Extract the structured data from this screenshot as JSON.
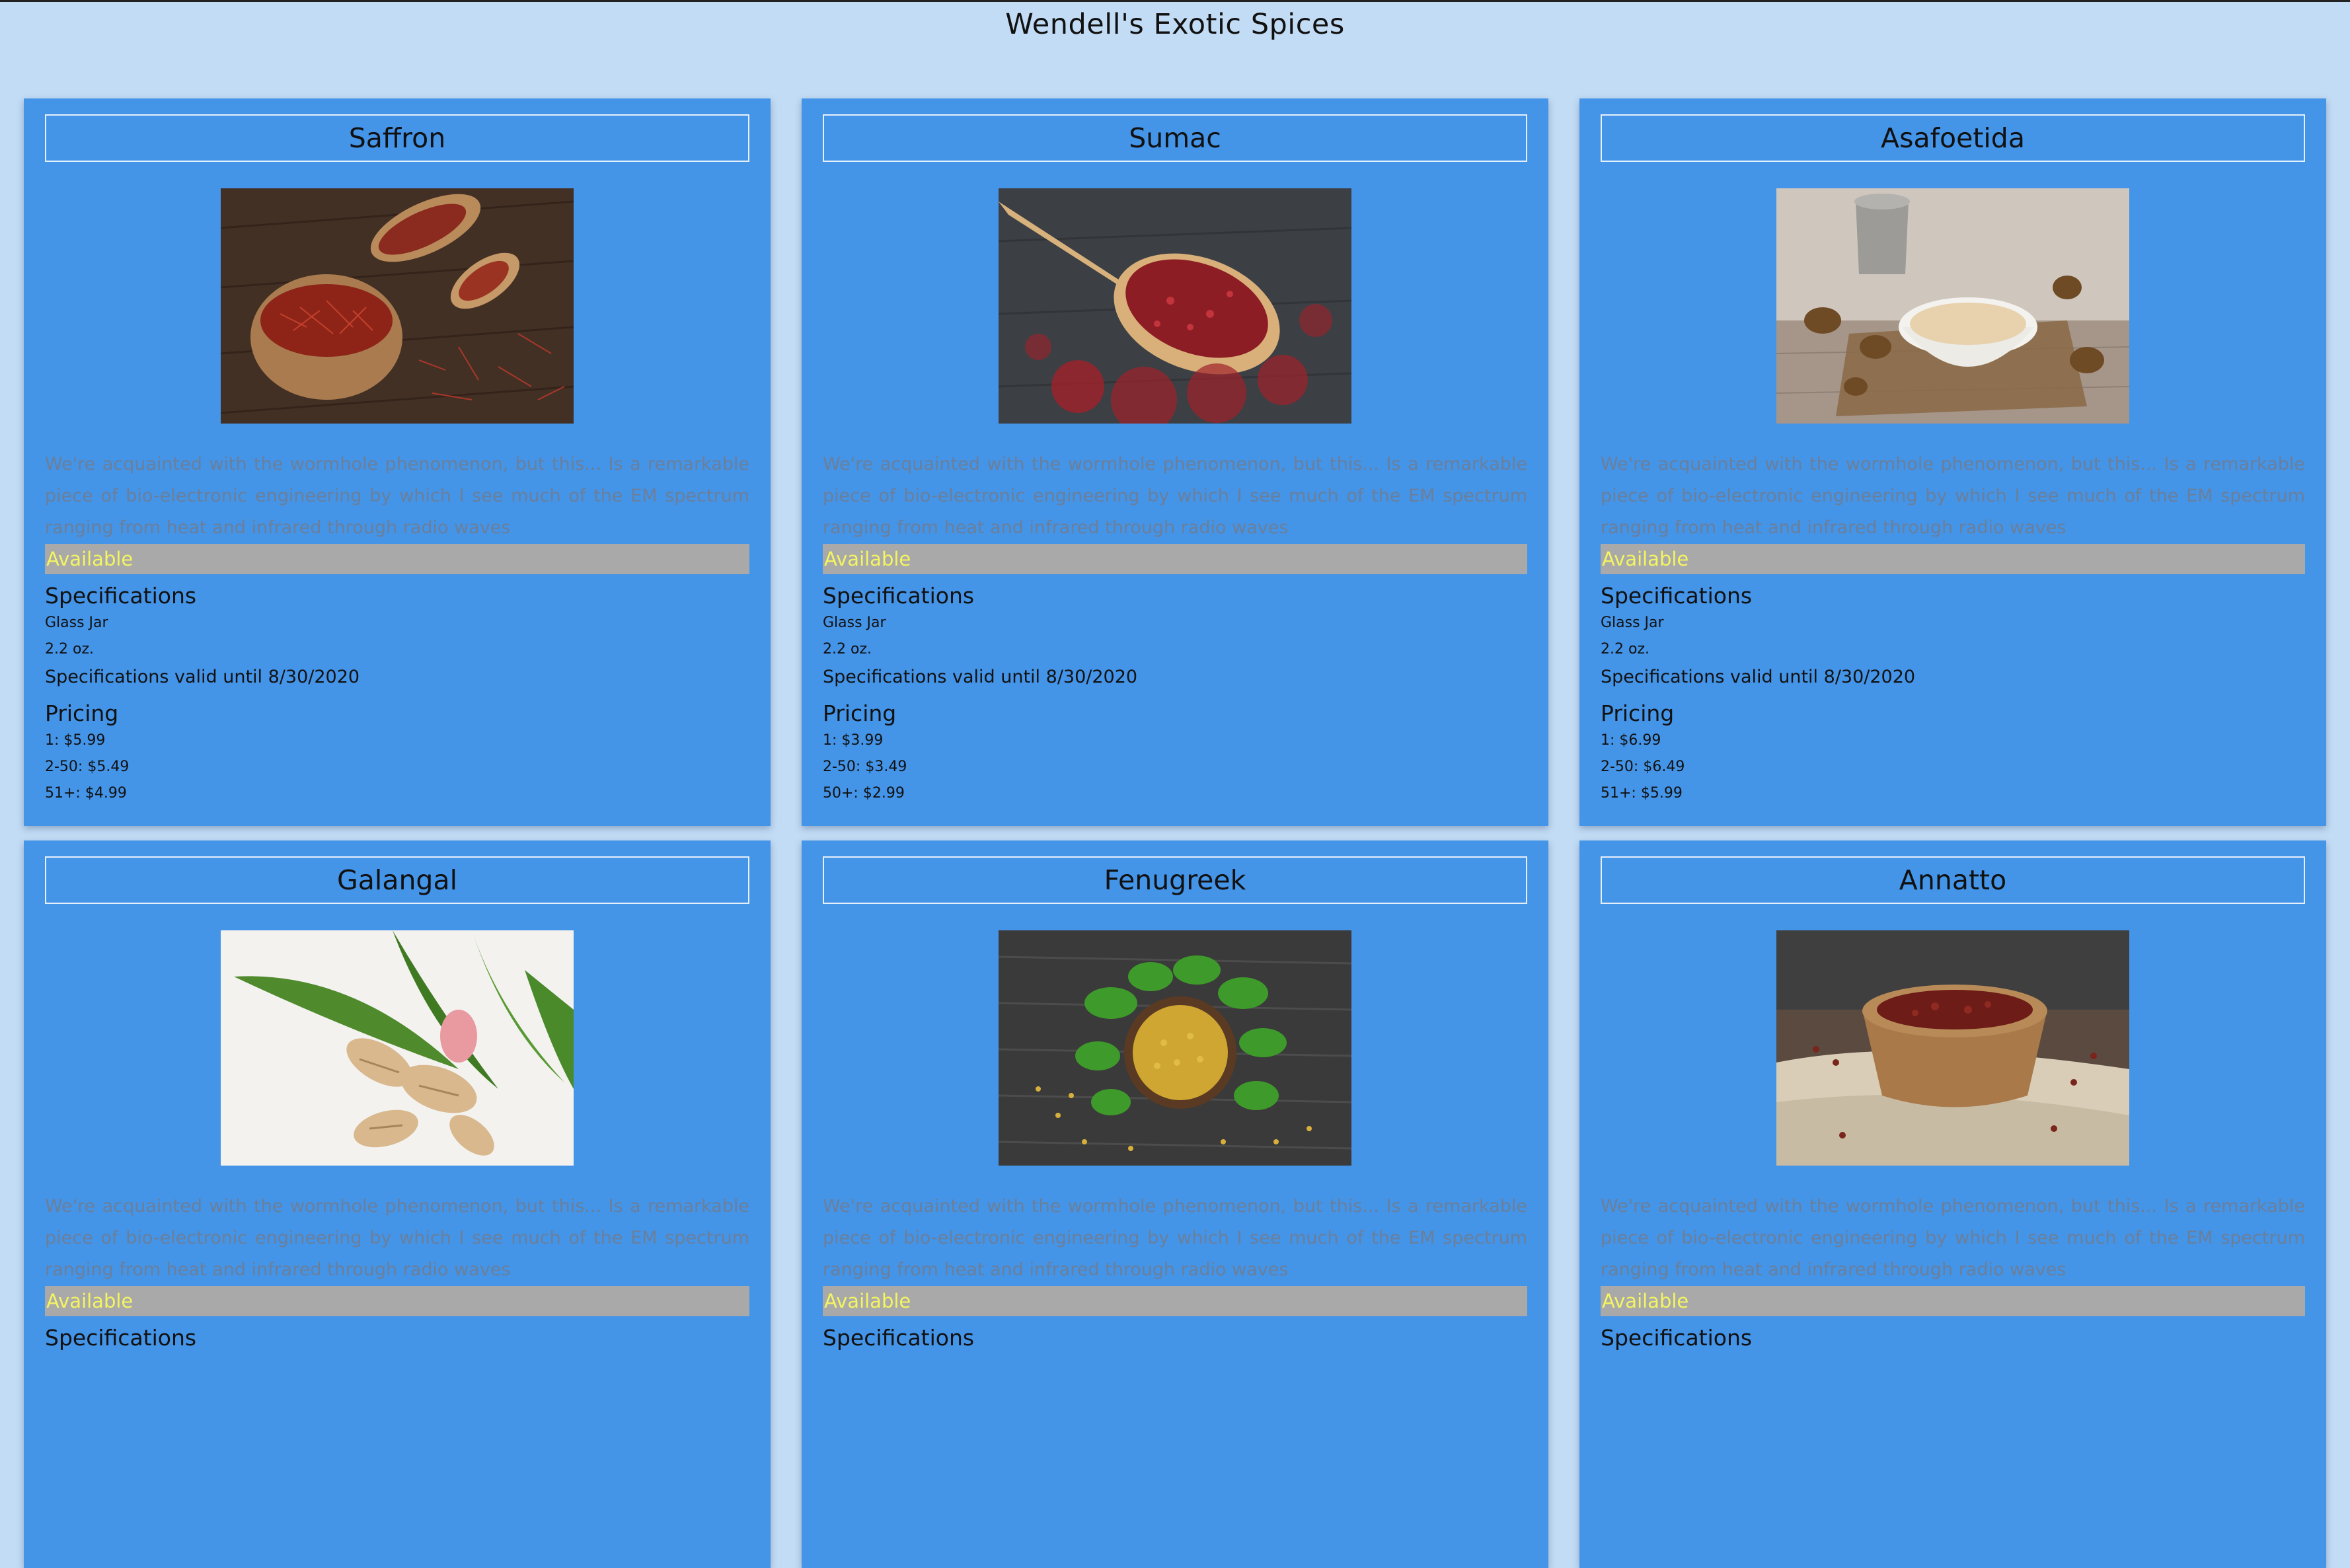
{
  "site": {
    "title": "Wendell's Exotic Spices"
  },
  "products": [
    {
      "name": "Saffron",
      "image": "saffron-photo",
      "description": "We're acquainted with the wormhole phenomenon, but this... Is a remarkable piece of bio-electronic engineering by which I see much of the EM spectrum ranging from heat and infrared through radio waves",
      "availability": "Available",
      "specs_heading": "Specifications",
      "spec_container": "Glass Jar",
      "spec_size": "2.2 oz.",
      "spec_valid": "Specifications valid until 8/30/2020",
      "pricing_heading": "Pricing",
      "price_1": "1: $5.99",
      "price_2": "2-50: $5.49",
      "price_3": "51+: $4.99"
    },
    {
      "name": "Sumac",
      "image": "sumac-photo",
      "description": "We're acquainted with the wormhole phenomenon, but this... Is a remarkable piece of bio-electronic engineering by which I see much of the EM spectrum ranging from heat and infrared through radio waves",
      "availability": "Available",
      "specs_heading": "Specifications",
      "spec_container": "Glass Jar",
      "spec_size": "2.2 oz.",
      "spec_valid": "Specifications valid until 8/30/2020",
      "pricing_heading": "Pricing",
      "price_1": "1: $3.99",
      "price_2": "2-50: $3.49",
      "price_3": "50+: $2.99"
    },
    {
      "name": "Asafoetida",
      "image": "asafoetida-photo",
      "description": "We're acquainted with the wormhole phenomenon, but this... Is a remarkable piece of bio-electronic engineering by which I see much of the EM spectrum ranging from heat and infrared through radio waves",
      "availability": "Available",
      "specs_heading": "Specifications",
      "spec_container": "Glass Jar",
      "spec_size": "2.2 oz.",
      "spec_valid": "Specifications valid until 8/30/2020",
      "pricing_heading": "Pricing",
      "price_1": "1: $6.99",
      "price_2": "2-50: $6.49",
      "price_3": "51+: $5.99"
    },
    {
      "name": "Galangal",
      "image": "galangal-photo",
      "description": "We're acquainted with the wormhole phenomenon, but this... Is a remarkable piece of bio-electronic engineering by which I see much of the EM spectrum ranging from heat and infrared through radio waves",
      "availability": "Available",
      "specs_heading": "Specifications",
      "spec_container": "",
      "spec_size": "",
      "spec_valid": "",
      "pricing_heading": "",
      "price_1": "",
      "price_2": "",
      "price_3": ""
    },
    {
      "name": "Fenugreek",
      "image": "fenugreek-photo",
      "description": "We're acquainted with the wormhole phenomenon, but this... Is a remarkable piece of bio-electronic engineering by which I see much of the EM spectrum ranging from heat and infrared through radio waves",
      "availability": "Available",
      "specs_heading": "Specifications",
      "spec_container": "",
      "spec_size": "",
      "spec_valid": "",
      "pricing_heading": "",
      "price_1": "",
      "price_2": "",
      "price_3": ""
    },
    {
      "name": "Annatto",
      "image": "annatto-photo",
      "description": "We're acquainted with the wormhole phenomenon, but this... Is a remarkable piece of bio-electronic engineering by which I see much of the EM spectrum ranging from heat and infrared through radio waves",
      "availability": "Available",
      "specs_heading": "Specifications",
      "spec_container": "",
      "spec_size": "",
      "spec_valid": "",
      "pricing_heading": "",
      "price_1": "",
      "price_2": "",
      "price_3": ""
    }
  ]
}
